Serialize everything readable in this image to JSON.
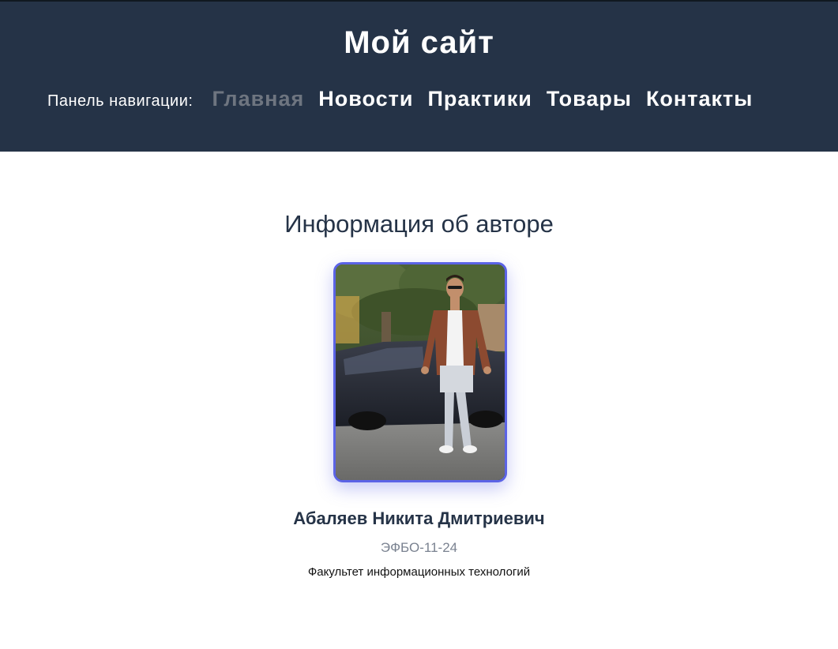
{
  "header": {
    "site_title": "Мой сайт",
    "nav_caption": "Панель навигации:",
    "nav_items": [
      {
        "label": "Главная",
        "active": true
      },
      {
        "label": "Новости",
        "active": false
      },
      {
        "label": "Практики",
        "active": false
      },
      {
        "label": "Товары",
        "active": false
      },
      {
        "label": "Контакты",
        "active": false
      }
    ]
  },
  "main": {
    "section_title": "Информация об авторе",
    "author": {
      "name": "Абаляев Никита Дмитриевич",
      "group": "ЭФБО-11-24",
      "faculty": "Факультет информационных технологий"
    }
  },
  "colors": {
    "header_bg": "#253347",
    "accent": "#5b63e6",
    "active_nav": "#6e7580"
  }
}
